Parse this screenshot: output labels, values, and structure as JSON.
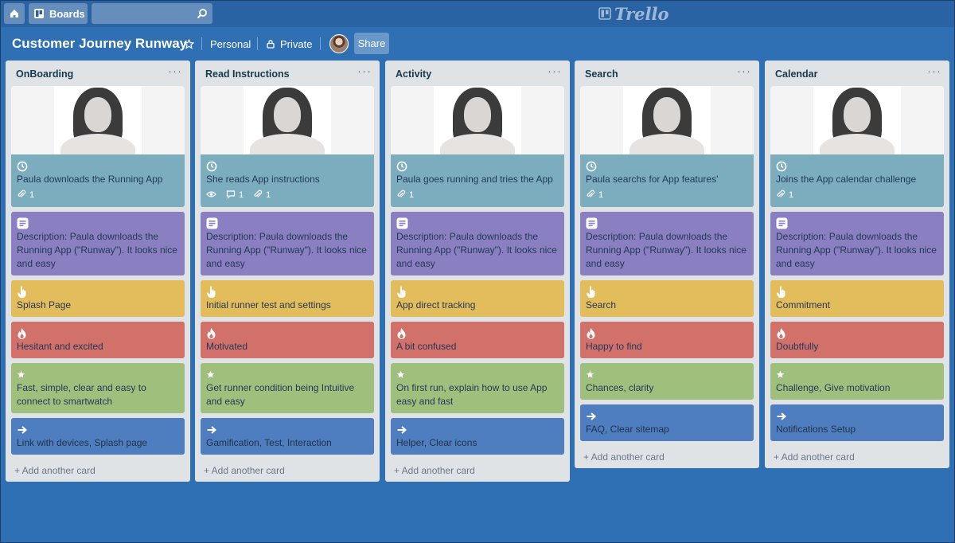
{
  "topbar": {
    "boards_label": "Boards",
    "logo_text": "Trello"
  },
  "board": {
    "title": "Customer Journey Runway",
    "team": "Personal",
    "visibility": "Private",
    "share_label": "Share"
  },
  "add_card_label": "+ Add another card",
  "lists": [
    {
      "title": "OnBoarding",
      "cards": {
        "photo": {
          "text": "Paula downloads the Running App",
          "attachments": "1"
        },
        "description": "Description: Paula downloads the Running App (\"Runway\"). It looks nice and easy",
        "touchpoint": "Splash Page",
        "emotion": "Hesitant and excited",
        "opportunity": "Fast, simple, clear and easy to connect to smartwatch",
        "next": "Link with devices, Splash page"
      }
    },
    {
      "title": "Read Instructions",
      "cards": {
        "photo": {
          "text": "She reads App instructions",
          "comments": "1",
          "attachments": "1"
        },
        "description": "Description: Paula downloads the Running App (\"Runway\"). It looks nice and easy",
        "touchpoint": "Initial runner test and settings",
        "emotion": "Motivated",
        "opportunity": "Get runner condition being Intuitive and easy",
        "next": "Gamification, Test, Interaction"
      }
    },
    {
      "title": "Activity",
      "cards": {
        "photo": {
          "text": "Paula goes running and tries the App",
          "attachments": "1"
        },
        "description": "Description: Paula downloads the Running App (\"Runway\"). It looks nice and easy",
        "touchpoint": "App direct tracking",
        "emotion": "A bit confused",
        "opportunity": "On first run, explain how to use App easy and fast",
        "next": "Helper, Clear icons"
      }
    },
    {
      "title": "Search",
      "cards": {
        "photo": {
          "text": "Paula searchs for App features'",
          "attachments": "1"
        },
        "description": "Description: Paula downloads the Running App (\"Runway\"). It looks nice and easy",
        "touchpoint": "Search",
        "emotion": "Happy to find",
        "opportunity": "Chances, clarity",
        "next": "FAQ, Clear sitemap"
      }
    },
    {
      "title": "Calendar",
      "cards": {
        "photo": {
          "text": "Joins the App calendar challenge",
          "attachments": "1"
        },
        "description": "Description: Paula downloads the Running App (\"Runway\"). It looks nice and easy",
        "touchpoint": "Commitment",
        "emotion": "Doubtfully",
        "opportunity": "Challenge, Give motivation",
        "next": "Notifications Setup"
      }
    }
  ],
  "colors": {
    "board_bg": "#2f6fb4",
    "photo_card": "#7badbf",
    "description_card": "#8a7fc0",
    "touchpoint_card": "#e3bd5b",
    "emotion_card": "#d2706a",
    "opportunity_card": "#9fc07d",
    "next_card": "#4f7ec0"
  },
  "icons": {
    "clock": "clock-icon",
    "attachment": "paperclip-icon",
    "watch": "eye-icon",
    "comment": "comment-icon",
    "description": "description-icon",
    "touchpoint": "pointer-hand-icon",
    "emotion": "fire-icon",
    "opportunity": "star-icon",
    "next": "arrow-right-icon"
  }
}
